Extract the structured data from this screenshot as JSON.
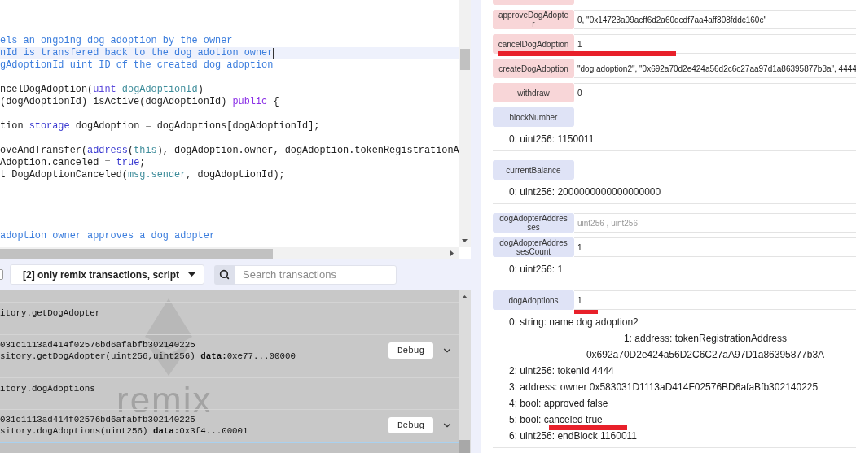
{
  "editor": {
    "lines": [
      {
        "active": false,
        "tokens": [
          {
            "kind": "comment",
            "text": "els an ongoing dog adoption by the owner"
          }
        ]
      },
      {
        "active": true,
        "tokens": [
          {
            "kind": "comment",
            "text": "nId is transfered back to the dog adotion owner"
          }
        ]
      },
      {
        "active": false,
        "tokens": [
          {
            "kind": "comment",
            "text": "gAdoptionId uint ID of the created dog adoption"
          }
        ]
      },
      {
        "active": false
      },
      {
        "active": false,
        "tokens": [
          {
            "kind": "plain",
            "text": "ncelDogAdoption("
          },
          {
            "kind": "type",
            "text": "uint"
          },
          {
            "kind": "variable",
            "text": " dogAdoptionId"
          },
          {
            "kind": "plain",
            "text": ")"
          }
        ]
      },
      {
        "active": false,
        "tokens": [
          {
            "kind": "plain",
            "text": "(dogAdoptionId) isActive(dogAdoptionId) "
          },
          {
            "kind": "visibility",
            "text": "public"
          },
          {
            "kind": "plain",
            "text": " {"
          }
        ]
      },
      {
        "active": false
      },
      {
        "active": false,
        "tokens": [
          {
            "kind": "plain",
            "text": "tion "
          },
          {
            "kind": "keyword",
            "text": "storage"
          },
          {
            "kind": "plain",
            "text": " dogAdoption "
          },
          {
            "kind": "operator",
            "text": "="
          },
          {
            "kind": "plain",
            "text": " dogAdoptions[dogAdoptionId];"
          }
        ]
      },
      {
        "active": false
      },
      {
        "active": false,
        "tokens": [
          {
            "kind": "plain",
            "text": "oveAndTransfer("
          },
          {
            "kind": "keyword",
            "text": "address"
          },
          {
            "kind": "plain",
            "text": "("
          },
          {
            "kind": "variable",
            "text": "this"
          },
          {
            "kind": "plain",
            "text": "), dogAdoption.owner, dogAdoption.tokenRegistrationA"
          }
        ]
      },
      {
        "active": false,
        "tokens": [
          {
            "kind": "plain",
            "text": "Adoption.canceled "
          },
          {
            "kind": "operator",
            "text": "="
          },
          {
            "kind": "keyword",
            "text": " true"
          },
          {
            "kind": "plain",
            "text": ";"
          }
        ]
      },
      {
        "active": false,
        "tokens": [
          {
            "kind": "plain",
            "text": "t DogAdoptionCanceled("
          },
          {
            "kind": "variable",
            "text": "msg.sender"
          },
          {
            "kind": "plain",
            "text": ", dogAdoptionId);"
          }
        ]
      },
      {
        "active": false
      },
      {
        "active": false
      },
      {
        "active": false
      },
      {
        "active": false
      },
      {
        "active": false,
        "tokens": [
          {
            "kind": "comment",
            "text": "adoption owner approves a dog adopter"
          }
        ]
      }
    ]
  },
  "terminal": {
    "checkbox": {
      "checked": false
    },
    "filter": "[2] only remix transactions, script",
    "search": {
      "placeholder": "Search transactions"
    },
    "logo_text": "remix",
    "log": [
      {
        "kind": "header",
        "text": "itory.getDogAdopter"
      },
      {
        "kind": "transaction",
        "lines": [
          "031d1113ad414f02576bd6afabfb302140225",
          "sitory.getDogAdopter(uint256,uint256) **data:**0xe77...00000"
        ],
        "button": "Debug"
      },
      {
        "kind": "header",
        "text": "itory.dogAdoptions"
      },
      {
        "kind": "transaction",
        "lines": [
          "031d1113ad414f02576bd6afabfb302140225",
          "sitory.dogAdoptions(uint256) **data:**0x3f4...00001"
        ],
        "button": "Debug"
      }
    ]
  },
  "contract": {
    "functions": [
      {
        "kind": "transact",
        "label": "approveDogAdopter",
        "value": "0, \"0x14723a09acff6d2a60dcdf7aa4aff308fddc160c\"",
        "underlined": false
      },
      {
        "kind": "transact",
        "label": "cancelDogAdoption",
        "value": "1",
        "underlined": true
      },
      {
        "kind": "transact",
        "label": "createDogAdoption",
        "value": "\"dog adoption2\", \"0x692a70d2e424a56d2c6c27aa97d1a86395877b3a\", 4444",
        "underlined": false
      },
      {
        "kind": "transact",
        "label": "withdraw",
        "value": "0",
        "underlined": false
      },
      {
        "kind": "call",
        "label": "blockNumber",
        "underlined": false,
        "results": [
          {
            "kind": "line",
            "text": "0: uint256: 1150011",
            "underlined": false
          }
        ]
      },
      {
        "kind": "call",
        "label": "currentBalance",
        "underlined": false,
        "results": [
          {
            "kind": "line",
            "text": "0: uint256: 2000000000000000000",
            "underlined": false
          }
        ]
      },
      {
        "kind": "call",
        "label": "dogAdopterAddresses",
        "placeholder": "uint256 , uint256",
        "underlined": false
      },
      {
        "kind": "call",
        "label": "dogAdopterAddressesCount",
        "value": "1",
        "underlined": false,
        "results": [
          {
            "kind": "line",
            "text": "0: uint256: 1",
            "underlined": false
          }
        ]
      },
      {
        "kind": "call",
        "label": "dogAdoptions",
        "value": "1",
        "underlined": true,
        "results": [
          {
            "kind": "line",
            "text": "0: string: name dog adoption2",
            "underlined": false
          },
          {
            "kind": "centered",
            "text": "1: address: tokenRegistrationAddress 0x692a70D2e424a56D2C6C27aA97D1a86395877b3A",
            "underlined": false
          },
          {
            "kind": "line",
            "text": "2: uint256: tokenId 4444",
            "underlined": false
          },
          {
            "kind": "line",
            "text": "3: address: owner 0x583031D1113aD414F02576BD6afaBfb302140225",
            "underlined": false
          },
          {
            "kind": "line",
            "text": "4: bool: approved false",
            "underlined": false
          },
          {
            "kind": "line",
            "text": "5: bool: canceled true",
            "underlined": true
          },
          {
            "kind": "line",
            "text": "6: uint256: endBlock 1160011",
            "underlined": false
          }
        ]
      }
    ]
  }
}
